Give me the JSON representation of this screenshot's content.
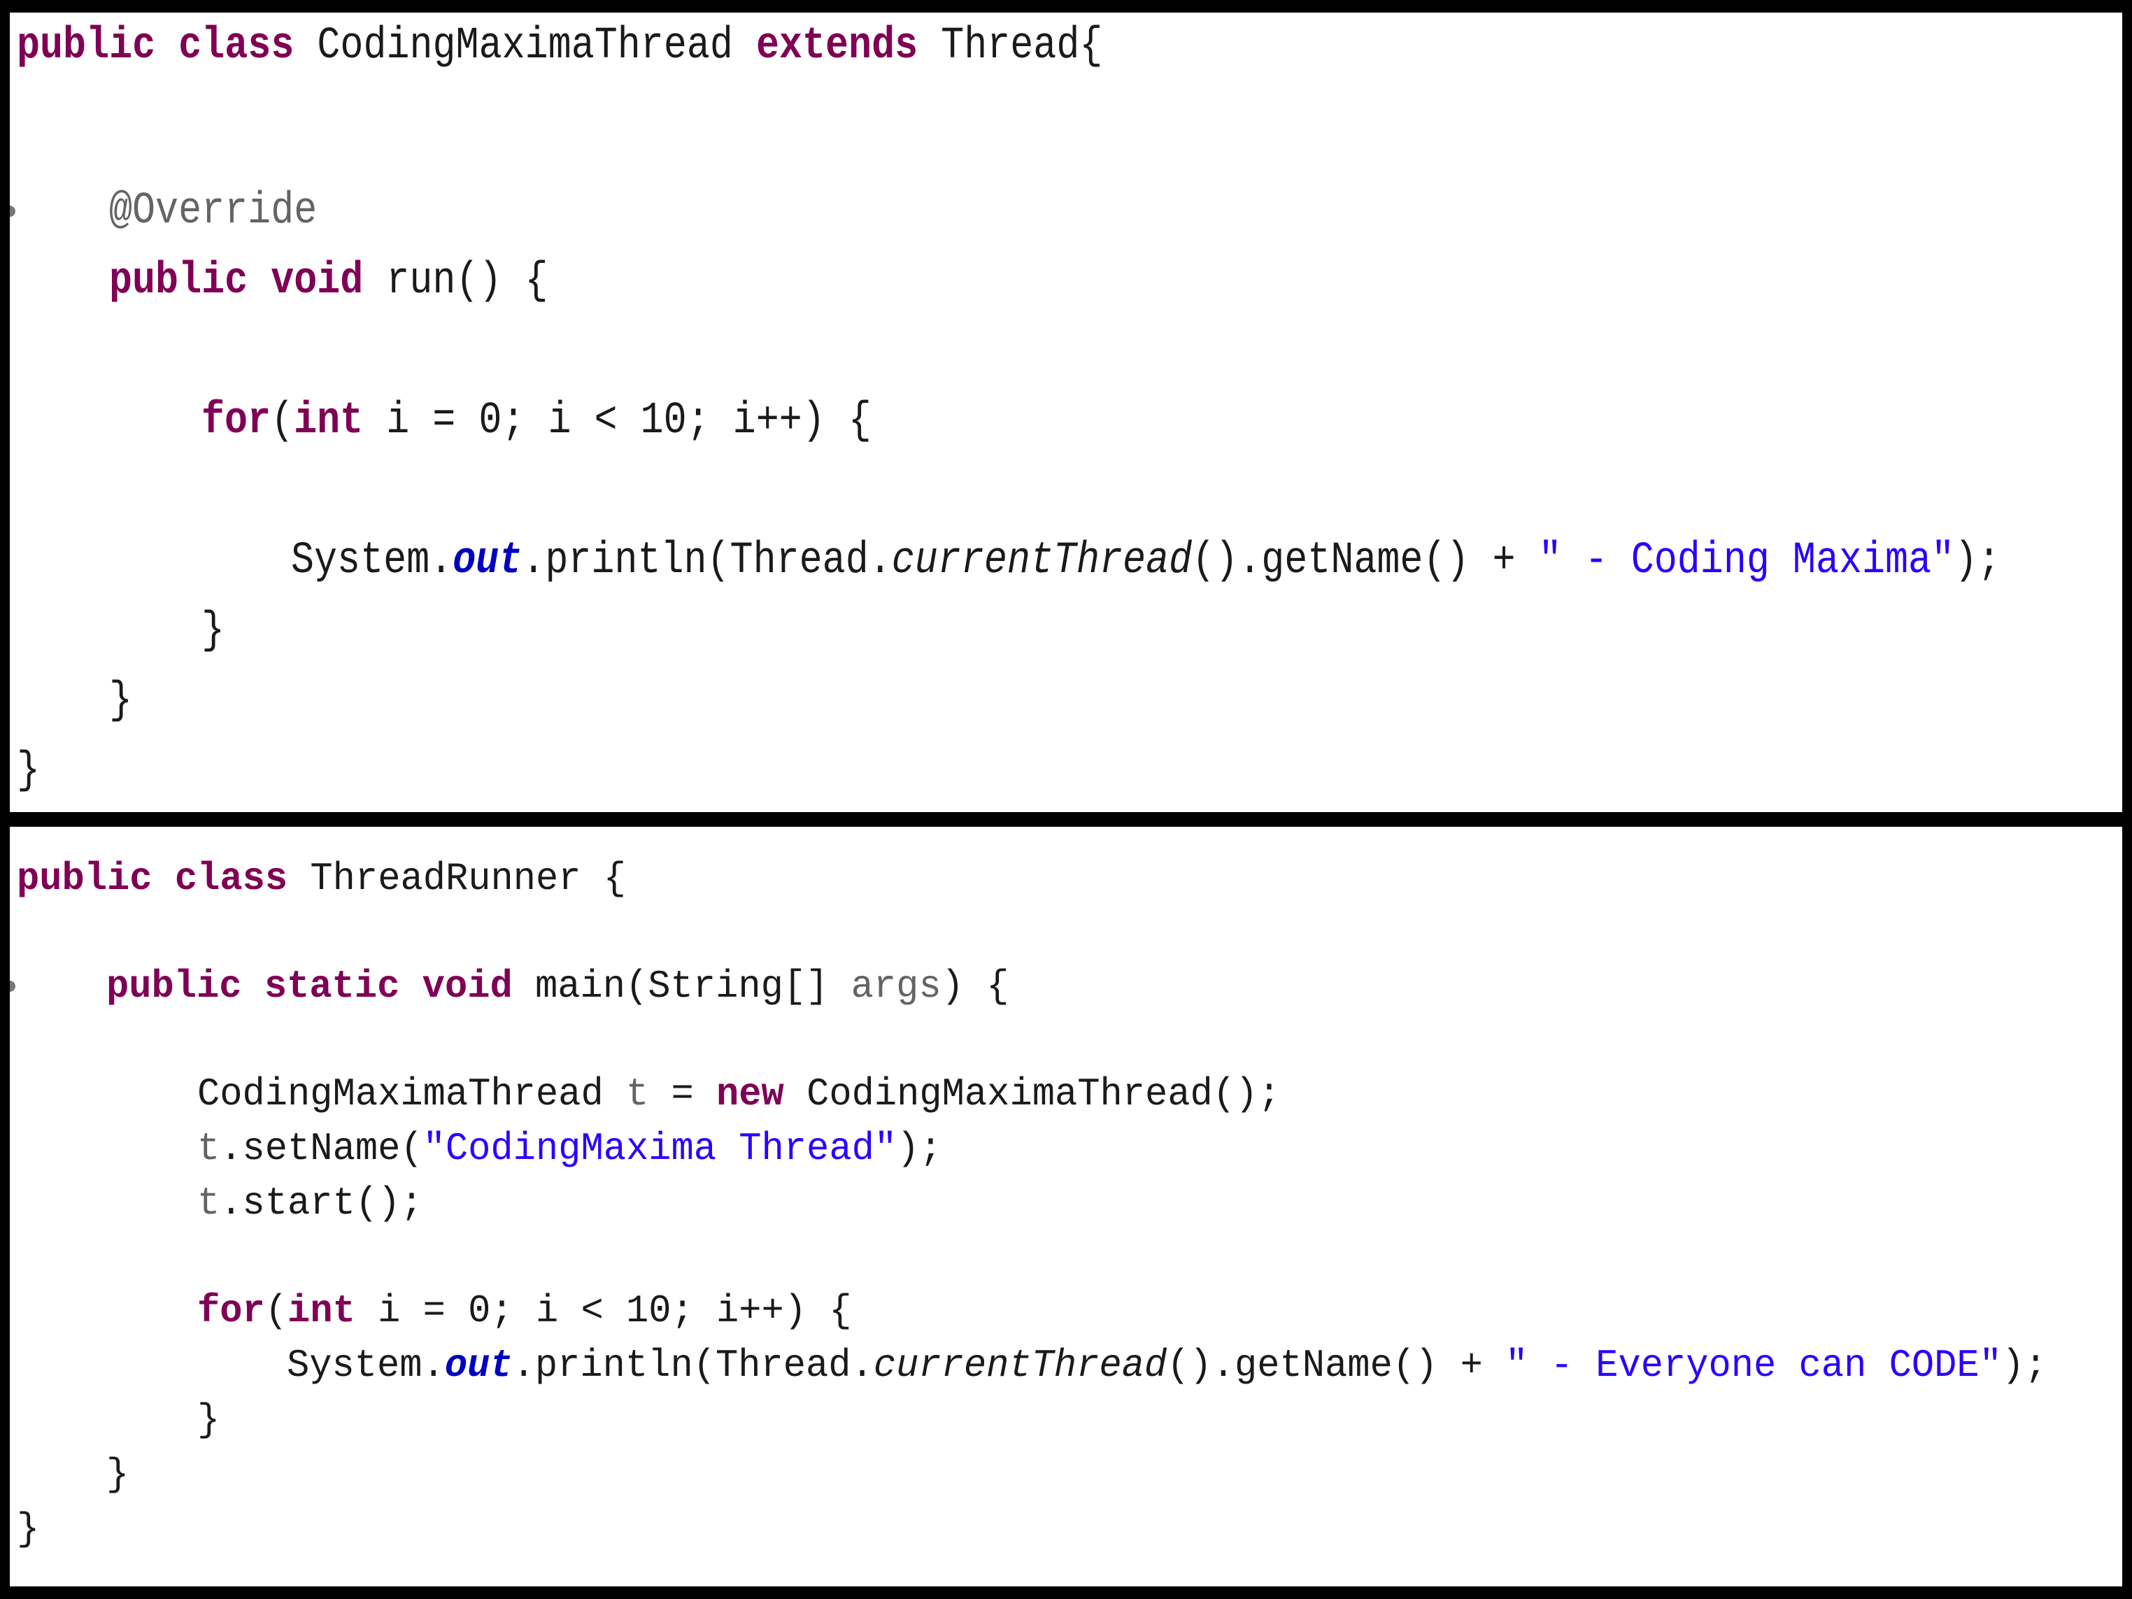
{
  "colors": {
    "keyword": "#7f0055",
    "string": "#2a00ff",
    "annotation": "#646464",
    "static_field": "#0000c0",
    "background": "#ffffff",
    "border": "#000000"
  },
  "top_panel": {
    "l1": {
      "kw1": "public",
      "kw2": "class",
      "name": "CodingMaximaThread",
      "kw3": "extends",
      "sup": "Thread{"
    },
    "l2": {
      "ann": "@Override"
    },
    "l3": {
      "kw1": "public",
      "kw2": "void",
      "rest": "run() {"
    },
    "l4": {
      "kw1": "for",
      "p1": "(",
      "kw2": "int",
      "rest": " i = 0; i < 10; i++) {"
    },
    "l5": {
      "a": "System.",
      "field": "out",
      "b": ".println(Thread.",
      "method": "currentThread",
      "c": "().getName() + ",
      "str": "\" - Coding Maxima\"",
      "d": ");"
    },
    "l6": "}",
    "l7": "}",
    "l8": "}"
  },
  "bottom_panel": {
    "l1": {
      "kw1": "public",
      "kw2": "class",
      "rest": "ThreadRunner {"
    },
    "l2": {
      "kw1": "public",
      "kw2": "static",
      "kw3": "void",
      "a": "main(String[] ",
      "arg": "args",
      "b": ") {"
    },
    "l3": {
      "a": "CodingMaximaThread ",
      "var": "t",
      "b": " = ",
      "kw": "new",
      "c": " CodingMaximaThread();"
    },
    "l4": {
      "var": "t",
      "a": ".setName(",
      "str": "\"CodingMaxima Thread\"",
      "b": ");"
    },
    "l5": {
      "var": "t",
      "a": ".start();"
    },
    "l6": {
      "kw1": "for",
      "p1": "(",
      "kw2": "int",
      "rest": " i = 0; i < 10; i++) {"
    },
    "l7": {
      "a": "System.",
      "field": "out",
      "b": ".println(Thread.",
      "method": "currentThread",
      "c": "().getName() + ",
      "str": "\" - Everyone can CODE\"",
      "d": ");"
    },
    "l8": "}",
    "l9": "}",
    "l10": "}"
  }
}
